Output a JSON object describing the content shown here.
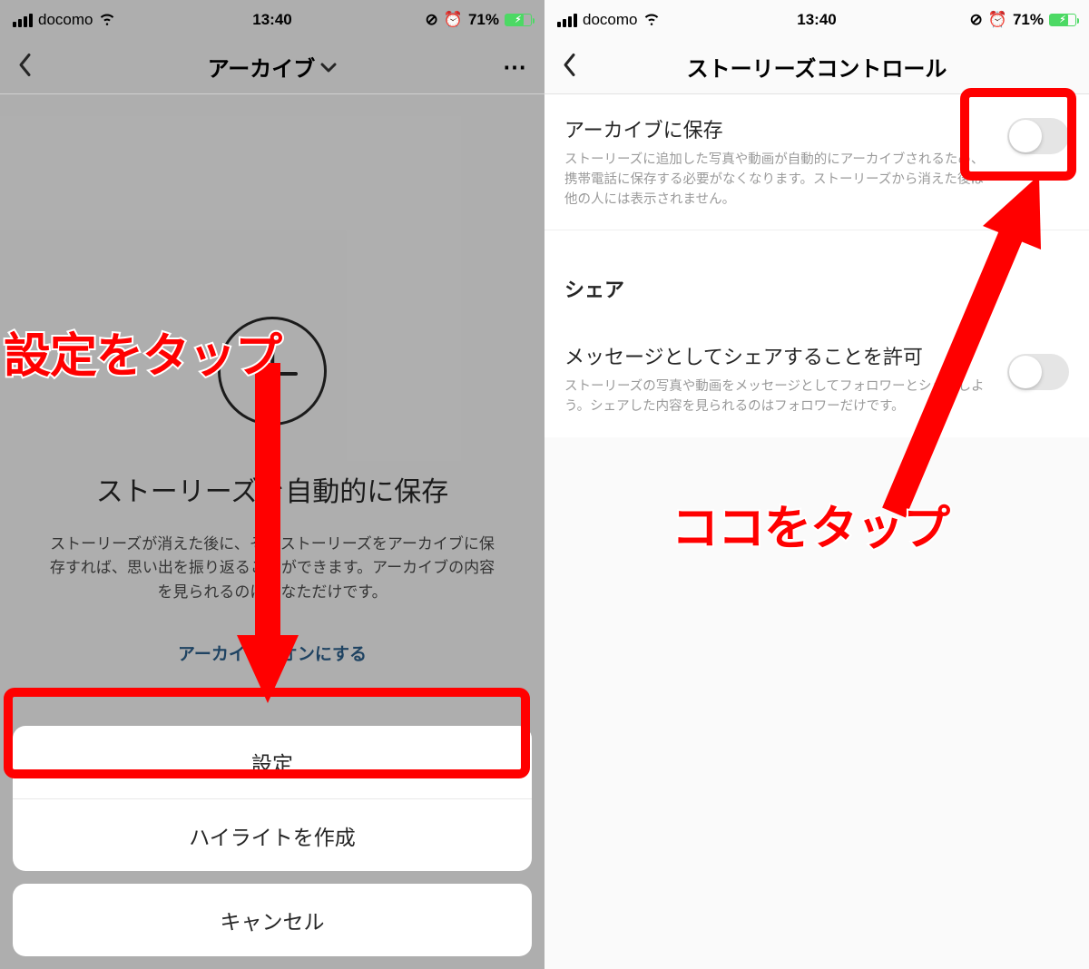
{
  "statusbar": {
    "carrier": "docomo",
    "time": "13:40",
    "battery_pct": "71%"
  },
  "left": {
    "nav_title": "アーカイブ",
    "content": {
      "heading": "ストーリーズを自動的に保存",
      "description": "ストーリーズが消えた後に、そのストーリーズをアーカイブに保存すれば、思い出を振り返ることができます。アーカイブの内容を見られるのはあなただけです。",
      "link": "アーカイブをオンにする"
    },
    "sheet": {
      "settings": "設定",
      "highlight": "ハイライトを作成",
      "cancel": "キャンセル"
    }
  },
  "right": {
    "nav_title": "ストーリーズコントロール",
    "row1": {
      "title": "アーカイブに保存",
      "sub": "ストーリーズに追加した写真や動画が自動的にアーカイブされるため、携帯電話に保存する必要がなくなります。ストーリーズから消えた後は他の人には表示されません。"
    },
    "section": "シェア",
    "row2": {
      "title": "メッセージとしてシェアすることを許可",
      "sub": "ストーリーズの写真や動画をメッセージとしてフォロワーとシェアしよう。シェアした内容を見られるのはフォロワーだけです。"
    }
  },
  "annotation": {
    "left_text": "設定をタップ",
    "right_text": "ココをタップ"
  }
}
